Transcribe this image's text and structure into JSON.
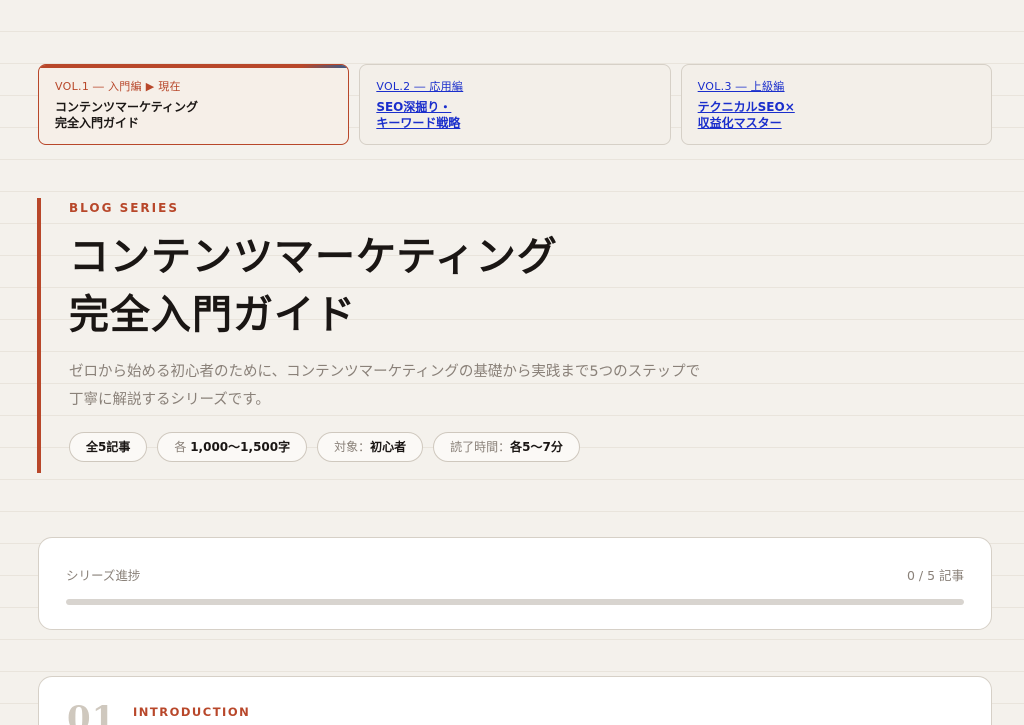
{
  "series_nav": [
    {
      "kicker": "VOL.1 ― 入門編 ▶ 現在",
      "title_line1": "コンテンツマーケティング",
      "title_line2": "完全入門ガイド"
    },
    {
      "kicker": "VOL.2 ― 応用編",
      "title_line1": "SEO深掘り・",
      "title_line2": "キーワード戦略"
    },
    {
      "kicker": "VOL.3 ― 上級編",
      "title_line1": "テクニカルSEO×",
      "title_line2": "収益化マスター"
    }
  ],
  "hero": {
    "eyebrow": "BLOG SERIES",
    "title_line1": "コンテンツマーケティング",
    "title_line2": "完全入門ガイド",
    "description": "ゼロから始める初心者のために、コンテンツマーケティングの基礎から実践まで5つのステップで丁寧に解説するシリーズです。",
    "tags": {
      "articles": "全5記事",
      "length_prefix": "各",
      "length_value": "1,000〜1,500字",
      "audience_prefix": "対象：",
      "audience_value": "初心者",
      "time_prefix": "読了時間：",
      "time_value": "各5〜7分"
    }
  },
  "progress": {
    "label": "シリーズ進捗",
    "count": "0 / 5 記事",
    "value": 0
  },
  "chapter": {
    "number": "01",
    "label": "INTRODUCTION"
  },
  "colors": {
    "accent": "#b8472a",
    "link": "#1a2ecc",
    "background": "#f4f1ec"
  }
}
